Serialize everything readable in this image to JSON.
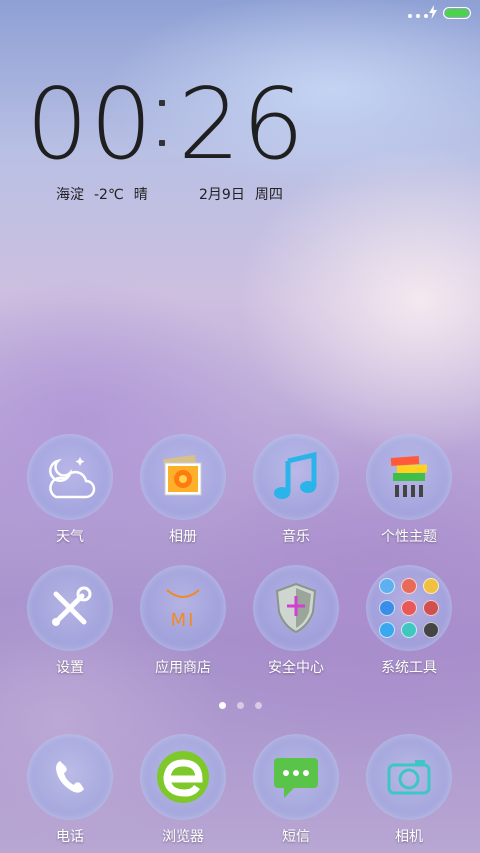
{
  "status_bar": {
    "battery_level": 1.0,
    "battery_color": "#4ed24e"
  },
  "clock": {
    "h1": "0",
    "h2": "0",
    "m1": "2",
    "m2": "6"
  },
  "weather_info": {
    "location": "海淀",
    "temperature": "-2℃",
    "condition": "晴"
  },
  "date_info": {
    "date": "2月9日",
    "weekday": "周四"
  },
  "apps_row1": [
    {
      "label": "天气",
      "icon": "weather-icon"
    },
    {
      "label": "相册",
      "icon": "gallery-icon"
    },
    {
      "label": "音乐",
      "icon": "music-icon"
    },
    {
      "label": "个性主题",
      "icon": "themes-icon"
    }
  ],
  "apps_row2": [
    {
      "label": "设置",
      "icon": "settings-icon"
    },
    {
      "label": "应用商店",
      "icon": "app-store-icon",
      "icon_text": "MI"
    },
    {
      "label": "安全中心",
      "icon": "security-icon"
    },
    {
      "label": "系统工具",
      "icon": "tools-folder-icon"
    }
  ],
  "pager": {
    "pages": 3,
    "current": 1
  },
  "dock": [
    {
      "label": "电话",
      "icon": "phone-icon"
    },
    {
      "label": "浏览器",
      "icon": "browser-icon"
    },
    {
      "label": "短信",
      "icon": "messages-icon"
    },
    {
      "label": "相机",
      "icon": "camera-icon"
    }
  ],
  "colors": {
    "accent_green": "#4ed24e",
    "browser_green": "#7ec82a",
    "store_orange": "#f08a24"
  }
}
